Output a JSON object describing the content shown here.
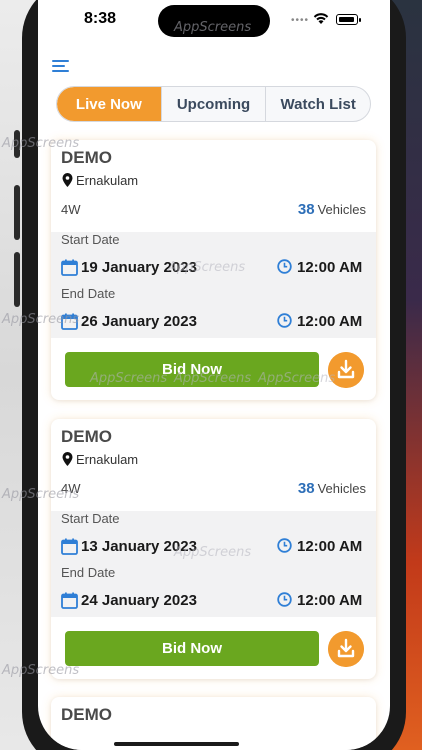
{
  "status_bar": {
    "time": "8:38"
  },
  "tabs": [
    {
      "label": "Live Now",
      "active": true
    },
    {
      "label": "Upcoming",
      "active": false
    },
    {
      "label": "Watch List",
      "active": false
    }
  ],
  "auctions": [
    {
      "title": "DEMO",
      "location": "Ernakulam",
      "vehicle_type": "4W",
      "vehicle_count": "38",
      "vehicles_label": "Vehicles",
      "start_label": "Start Date",
      "start_date": "19 January 2023",
      "start_time": "12:00 AM",
      "end_label": "End Date",
      "end_date": "26 January 2023",
      "end_time": "12:00 AM",
      "bid_label": "Bid Now"
    },
    {
      "title": "DEMO",
      "location": "Ernakulam",
      "vehicle_type": "4W",
      "vehicle_count": "38",
      "vehicles_label": "Vehicles",
      "start_label": "Start Date",
      "start_date": "13 January 2023",
      "start_time": "12:00 AM",
      "end_label": "End Date",
      "end_date": "24 January 2023",
      "end_time": "12:00 AM",
      "bid_label": "Bid Now"
    },
    {
      "title": "DEMO"
    }
  ],
  "watermark": "AppScreens",
  "colors": {
    "accent_orange": "#f29a2e",
    "bid_green": "#6aa71f",
    "count_blue": "#2e6fb8",
    "menu_blue": "#2f7fd6"
  },
  "icons": [
    "menu-icon",
    "location-pin-icon",
    "calendar-icon",
    "clock-icon",
    "download-icon",
    "wifi-icon",
    "battery-icon"
  ]
}
